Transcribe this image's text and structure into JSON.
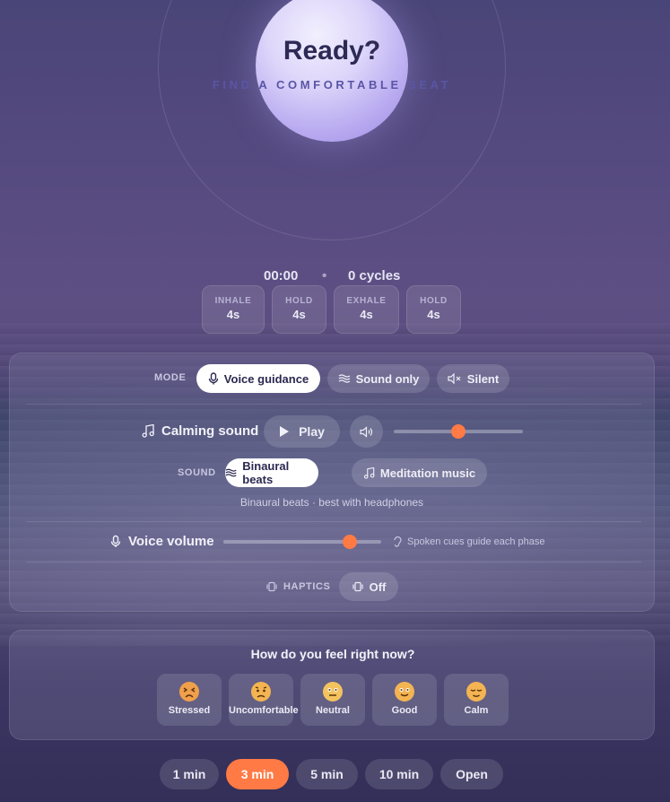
{
  "hero": {
    "title": "Ready?",
    "subtitle": "FIND A COMFORTABLE SEAT"
  },
  "stats": {
    "time": "00:00",
    "separator": "•",
    "cycles": "0 cycles"
  },
  "phases": [
    {
      "label": "INHALE",
      "value": "4s"
    },
    {
      "label": "HOLD",
      "value": "4s"
    },
    {
      "label": "EXHALE",
      "value": "4s"
    },
    {
      "label": "HOLD",
      "value": "4s"
    }
  ],
  "mode": {
    "label": "MODE",
    "options": [
      {
        "label": "Voice guidance",
        "icon": "microphone-icon",
        "active": true
      },
      {
        "label": "Sound only",
        "icon": "waves-icon",
        "active": false
      },
      {
        "label": "Silent",
        "icon": "mute-icon",
        "active": false
      }
    ]
  },
  "calming_sound": {
    "label": "Calming sound",
    "play_label": "Play",
    "volume": 0.5
  },
  "sound": {
    "label": "SOUND",
    "options": [
      {
        "label": "Binaural beats",
        "icon": "waves-icon",
        "active": true
      },
      {
        "label": "Meditation music",
        "icon": "music-note-icon",
        "active": false
      }
    ],
    "note": "Binaural beats · best with headphones"
  },
  "voice": {
    "label": "Voice volume",
    "volume": 0.8,
    "hint": "Spoken cues guide each phase"
  },
  "haptics": {
    "label": "HAPTICS",
    "toggle_label": "Off"
  },
  "feel": {
    "question": "How do you feel right now?",
    "moods": [
      {
        "label": "Stressed",
        "icon": "stressed-face-icon"
      },
      {
        "label": "Uncomfortable",
        "icon": "uncomfortable-face-icon"
      },
      {
        "label": "Neutral",
        "icon": "neutral-face-icon"
      },
      {
        "label": "Good",
        "icon": "good-face-icon"
      },
      {
        "label": "Calm",
        "icon": "calm-face-icon"
      }
    ]
  },
  "durations": [
    {
      "label": "1 min",
      "active": false
    },
    {
      "label": "3 min",
      "active": true
    },
    {
      "label": "5 min",
      "active": false
    },
    {
      "label": "10 min",
      "active": false
    },
    {
      "label": "Open",
      "active": false
    }
  ],
  "colors": {
    "accent": "#ff7a45",
    "orb": "#c9bdf6",
    "title": "#2d2a55"
  }
}
